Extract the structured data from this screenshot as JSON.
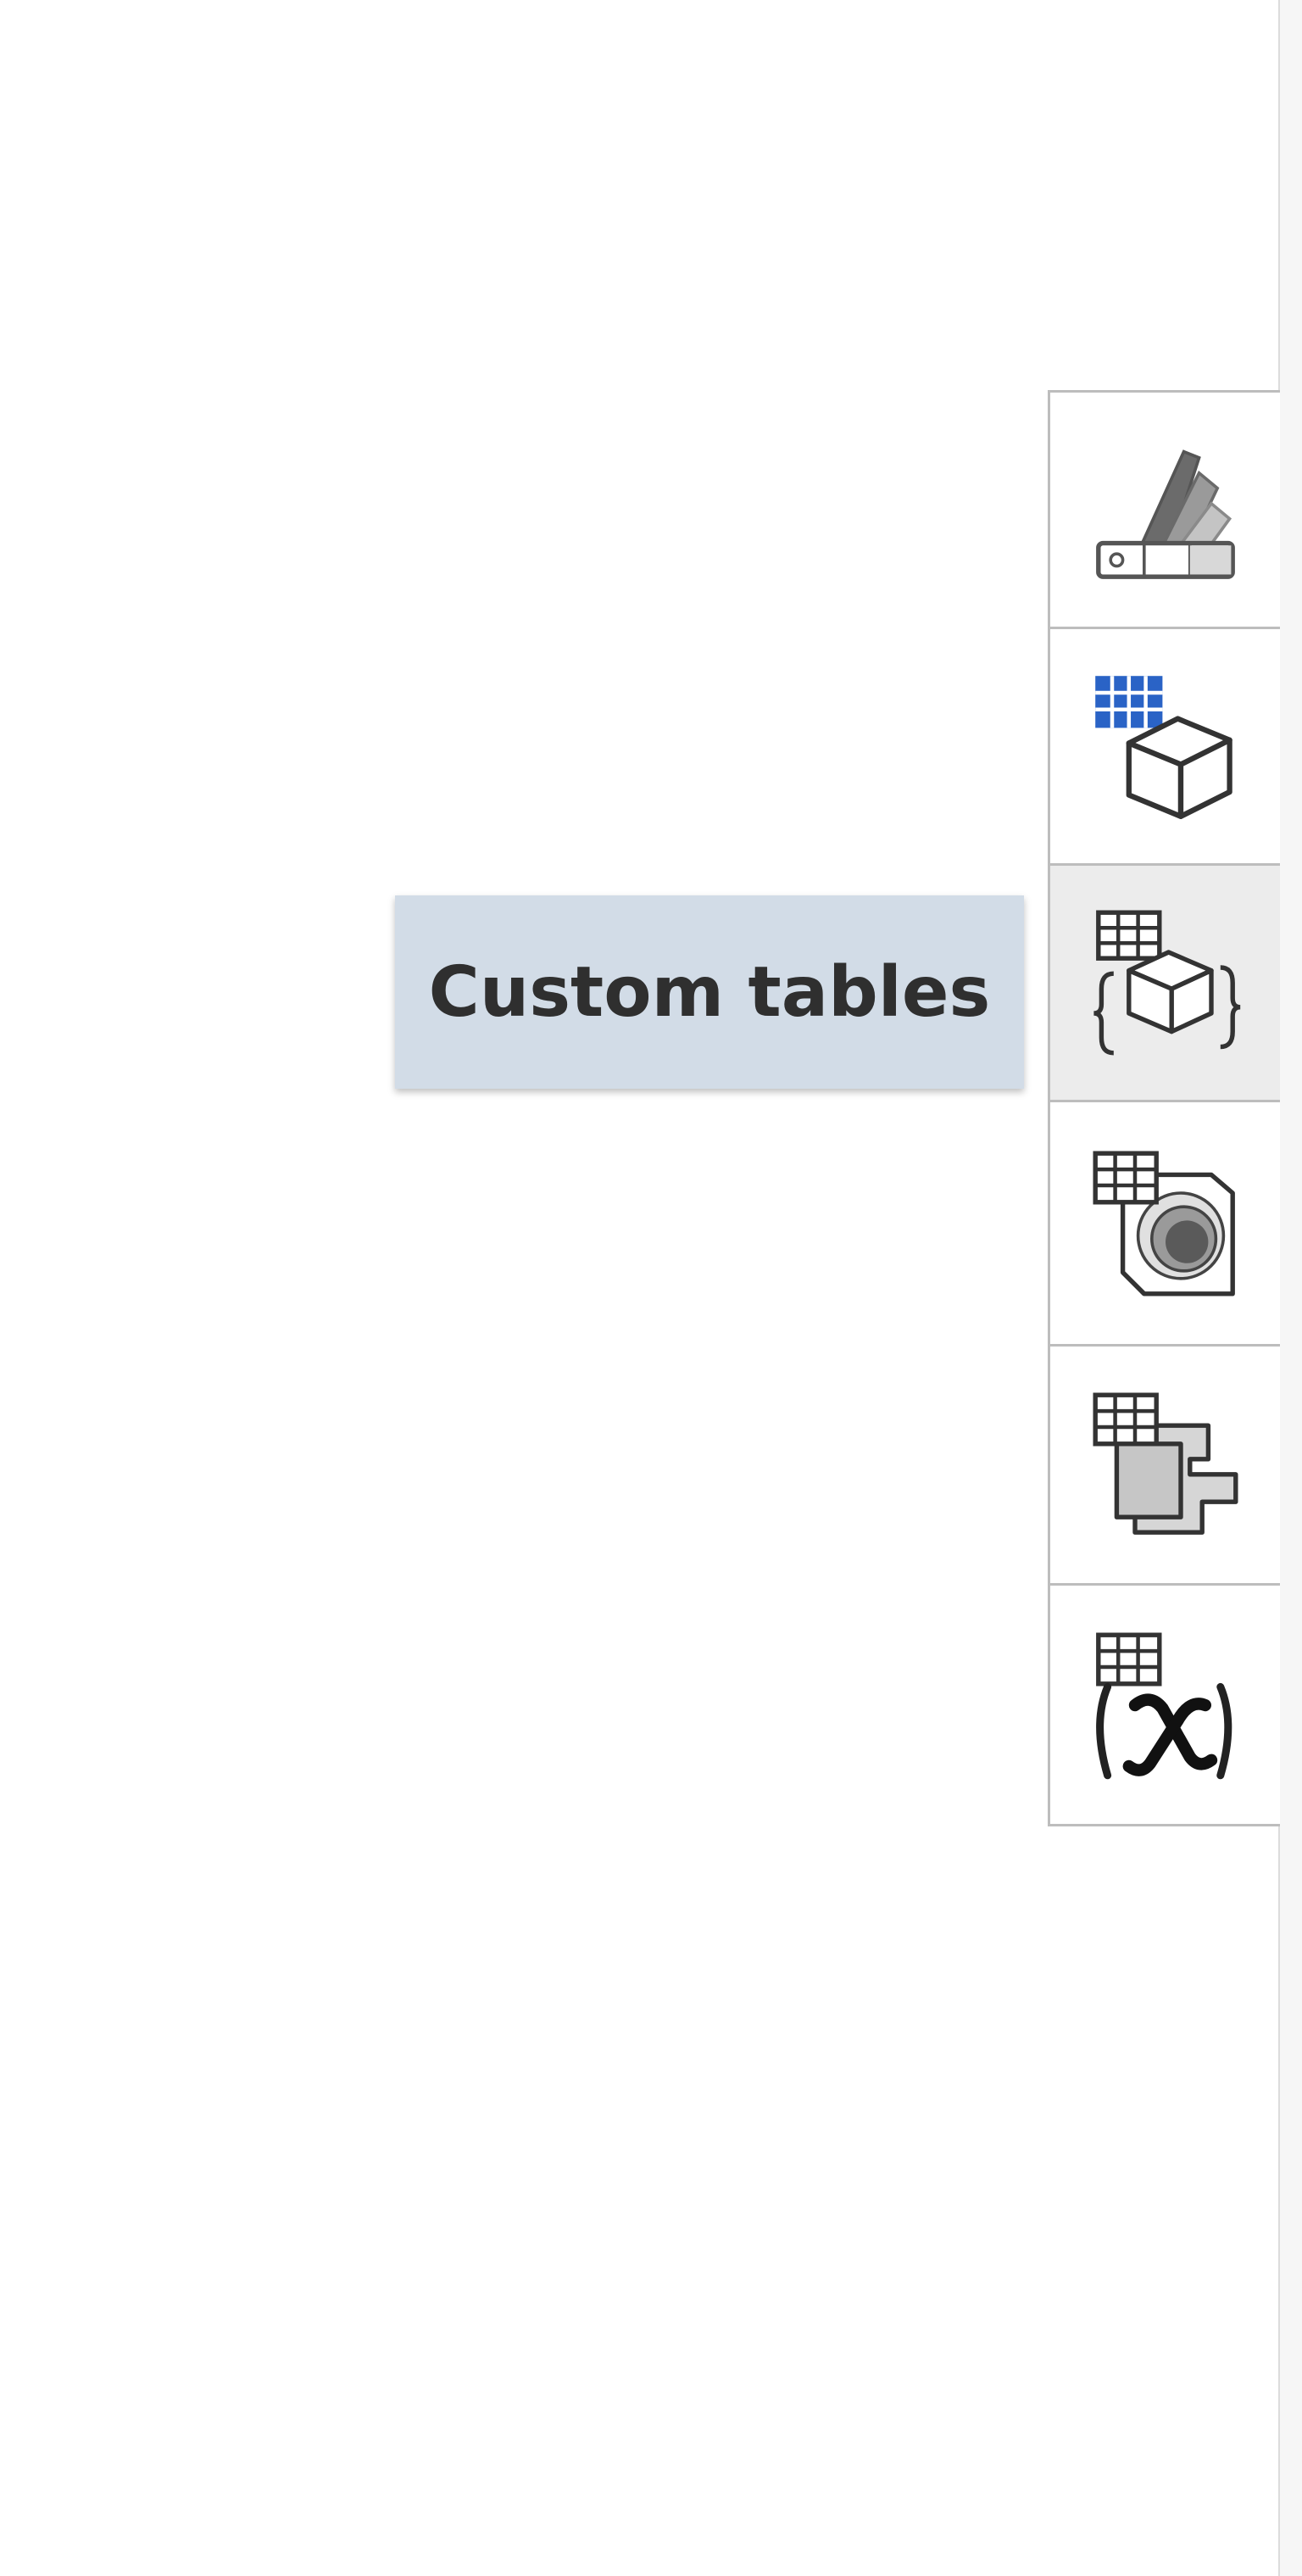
{
  "tooltip": {
    "text": "Custom tables"
  },
  "toolbar": {
    "items": [
      {
        "name": "appearance-swatch",
        "icon": "color-swatch-icon",
        "active": false
      },
      {
        "name": "configured-part-table",
        "icon": "table-cube-icon",
        "active": false
      },
      {
        "name": "custom-tables",
        "icon": "table-cube-braces-icon",
        "active": true
      },
      {
        "name": "table-hole",
        "icon": "table-hole-icon",
        "active": false
      },
      {
        "name": "table-sheet-metal",
        "icon": "table-sheet-metal-icon",
        "active": false
      },
      {
        "name": "table-function",
        "icon": "table-function-icon",
        "active": false
      }
    ]
  },
  "colors": {
    "tooltip_bg": "#d2dce7",
    "active_bg": "#ececec",
    "grid_blue": "#2a63c6",
    "border": "#bdbdbd"
  }
}
